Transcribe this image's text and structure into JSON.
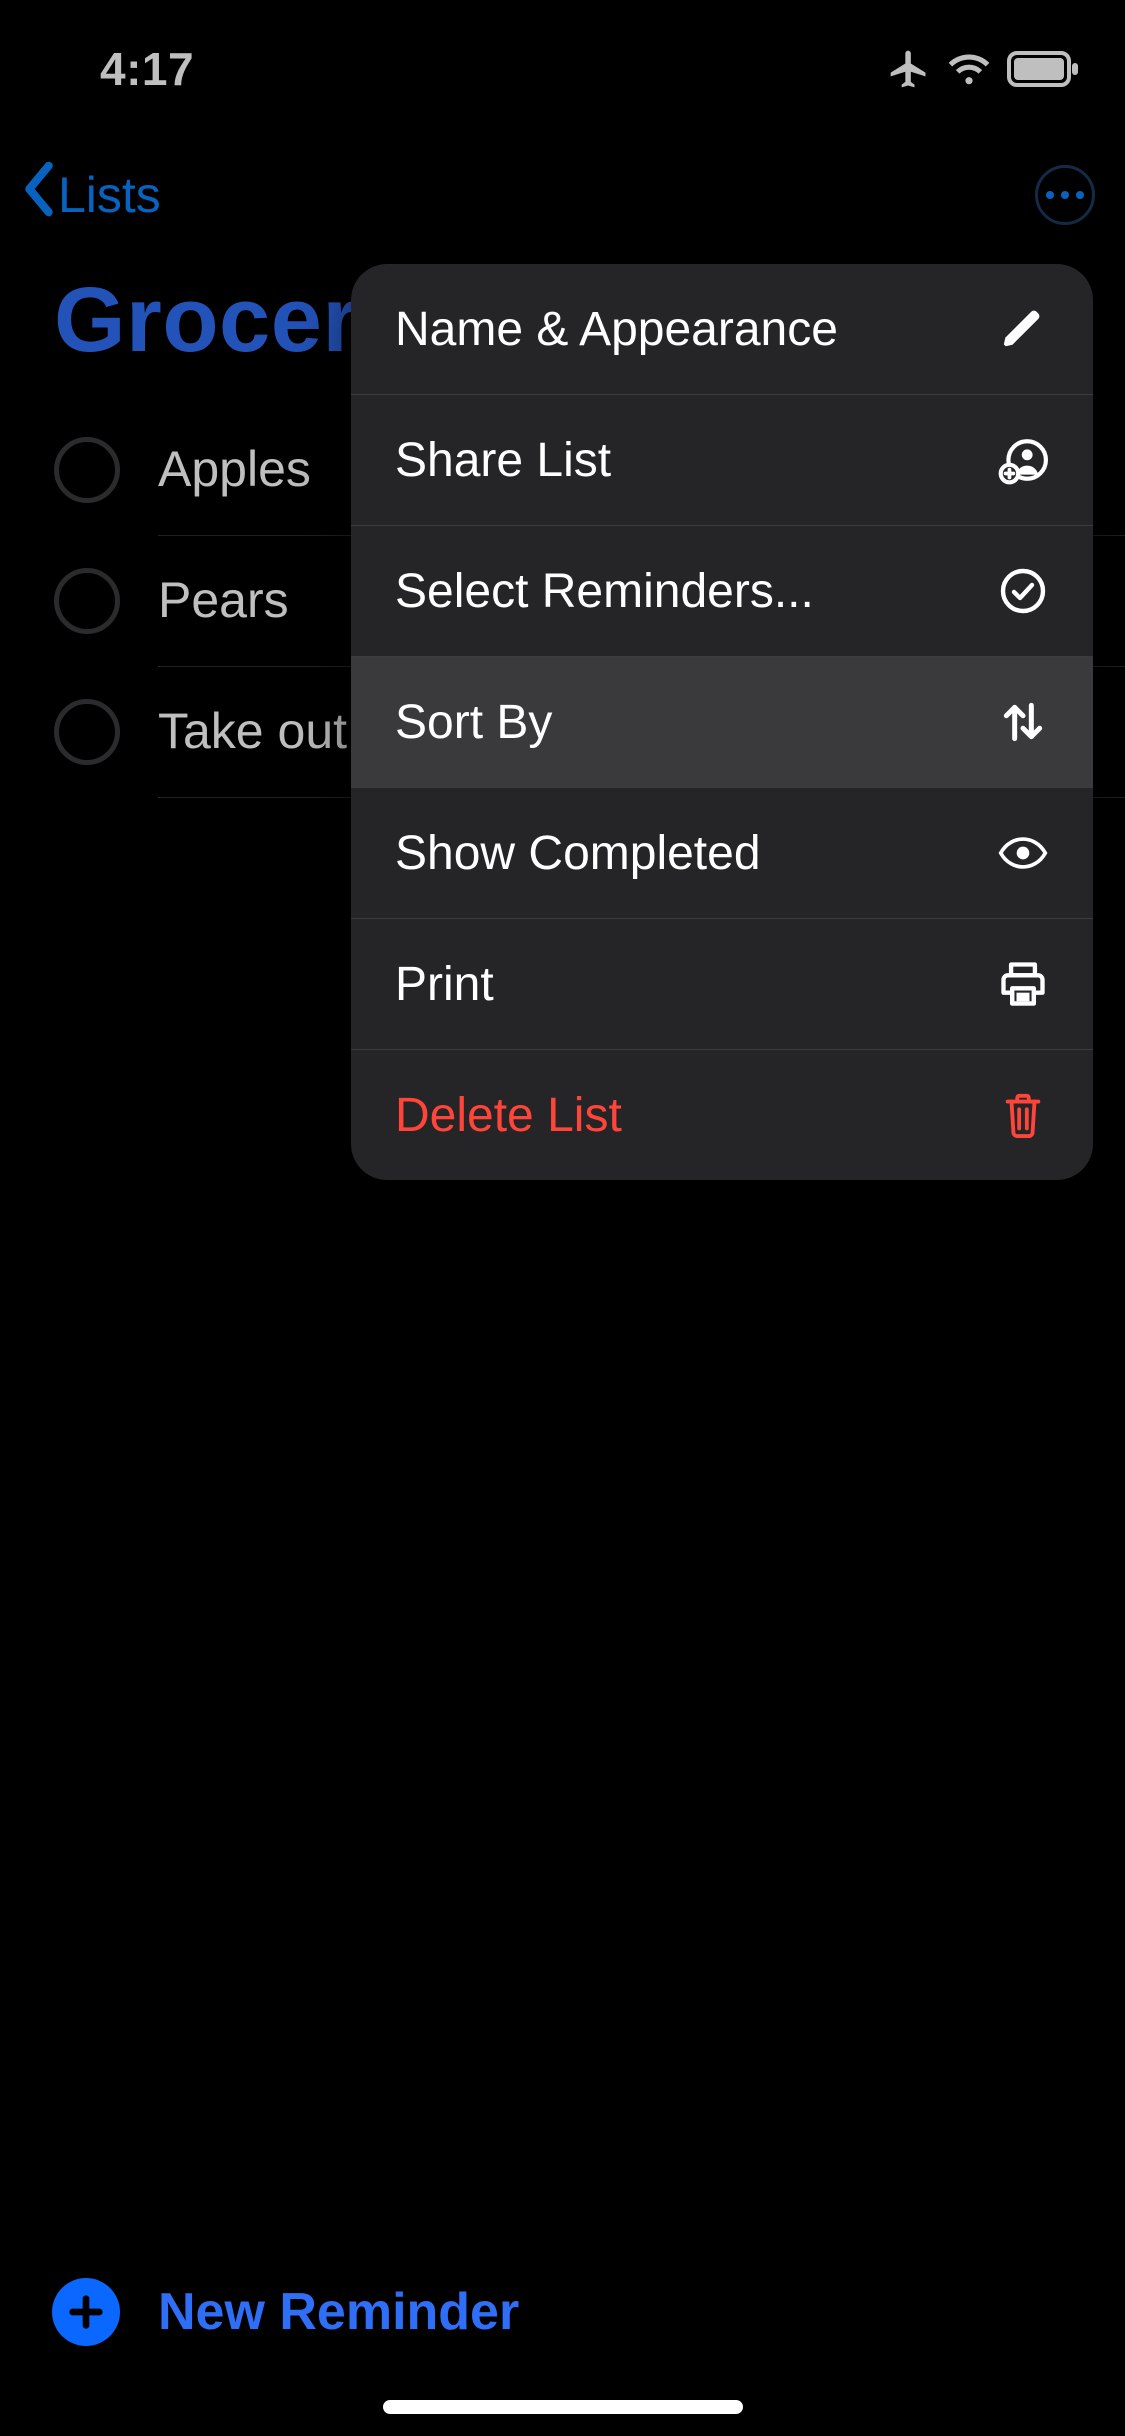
{
  "status": {
    "time": "4:17"
  },
  "nav": {
    "back_label": "Lists"
  },
  "list": {
    "title": "Groceries",
    "items": [
      {
        "text": "Apples"
      },
      {
        "text": "Pears"
      },
      {
        "text": "Take out"
      }
    ]
  },
  "menu": {
    "items": [
      {
        "label": "Name & Appearance",
        "icon": "pencil-icon",
        "highlighted": false,
        "destructive": false
      },
      {
        "label": "Share List",
        "icon": "share-person-icon",
        "highlighted": false,
        "destructive": false
      },
      {
        "label": "Select Reminders...",
        "icon": "checkmark-circle-icon",
        "highlighted": false,
        "destructive": false
      },
      {
        "label": "Sort By",
        "icon": "sort-arrows-icon",
        "highlighted": true,
        "destructive": false
      },
      {
        "label": "Show Completed",
        "icon": "eye-icon",
        "highlighted": false,
        "destructive": false
      },
      {
        "label": "Print",
        "icon": "printer-icon",
        "highlighted": false,
        "destructive": false
      },
      {
        "label": "Delete List",
        "icon": "trash-icon",
        "highlighted": false,
        "destructive": true
      }
    ]
  },
  "bottom": {
    "new_reminder_label": "New Reminder"
  }
}
